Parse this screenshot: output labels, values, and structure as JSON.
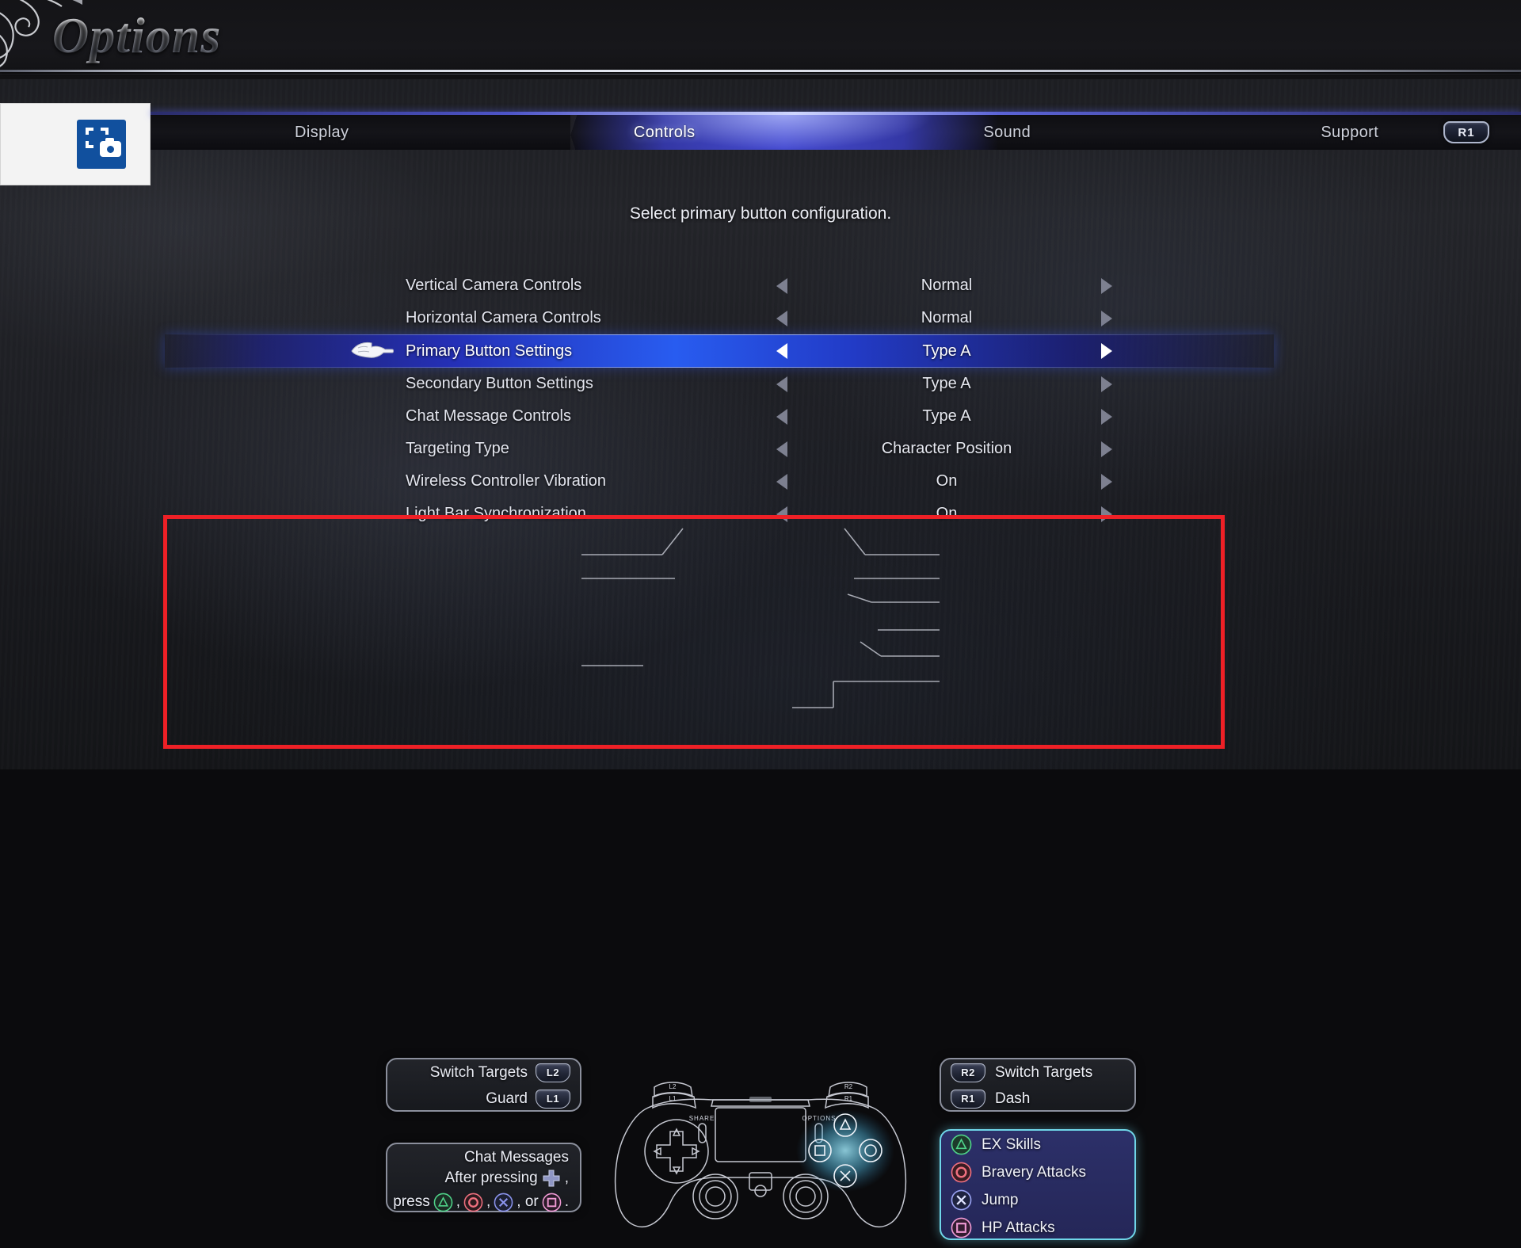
{
  "header": {
    "title": "Options"
  },
  "overlay": {
    "icon": "screenshot-camera-icon"
  },
  "tabs": {
    "items": [
      {
        "label": "Display",
        "active": false
      },
      {
        "label": "Controls",
        "active": true
      },
      {
        "label": "Sound",
        "active": false
      },
      {
        "label": "Support",
        "active": false
      }
    ],
    "shortcut_badge": "R1"
  },
  "instruction": "Select primary button configuration.",
  "settings": {
    "rows": [
      {
        "label": "Vertical Camera Controls",
        "value": "Normal",
        "selected": false
      },
      {
        "label": "Horizontal Camera Controls",
        "value": "Normal",
        "selected": false
      },
      {
        "label": "Primary Button Settings",
        "value": "Type A",
        "selected": true
      },
      {
        "label": "Secondary Button Settings",
        "value": "Type A",
        "selected": false
      },
      {
        "label": "Chat Message Controls",
        "value": "Type A",
        "selected": false
      },
      {
        "label": "Targeting Type",
        "value": "Character Position",
        "selected": false
      },
      {
        "label": "Wireless Controller Vibration",
        "value": "On",
        "selected": false
      },
      {
        "label": "Light Bar Synchronization",
        "value": "On",
        "selected": false
      }
    ]
  },
  "controller_legend": {
    "left_top": [
      {
        "action": "Switch Targets",
        "button": "L2"
      },
      {
        "action": "Guard",
        "button": "L1"
      }
    ],
    "right_top": [
      {
        "button": "R2",
        "action": "Switch Targets"
      },
      {
        "button": "R1",
        "action": "Dash"
      }
    ],
    "chat_panel": {
      "title": "Chat Messages",
      "line2_prefix": "After pressing",
      "line2_suffix": ",",
      "line3_prefix": "press",
      "sep1": ",",
      "sep2": ",",
      "or": ", or",
      "end": ".",
      "dpad_icon": "dpad-icon",
      "buttons": [
        "triangle",
        "circle",
        "cross",
        "square"
      ]
    },
    "face_panel": [
      {
        "button": "triangle",
        "action": "EX Skills"
      },
      {
        "button": "circle",
        "action": "Bravery Attacks"
      },
      {
        "button": "cross",
        "action": "Jump"
      },
      {
        "button": "square",
        "action": "HP Attacks"
      }
    ],
    "controller_labels": {
      "share": "SHARE",
      "options": "OPTIONS",
      "l1": "L1",
      "l2": "L2",
      "r1": "R1",
      "r2": "R2"
    }
  },
  "annotation": {
    "color": "#ee2026"
  },
  "colors": {
    "accent_blue": "#2a5cf0",
    "highlight_cyan": "#6fd6e8",
    "triangle": "#3fbf72",
    "circle": "#e8596a",
    "cross": "#7d86e8",
    "square": "#e87fc4"
  }
}
